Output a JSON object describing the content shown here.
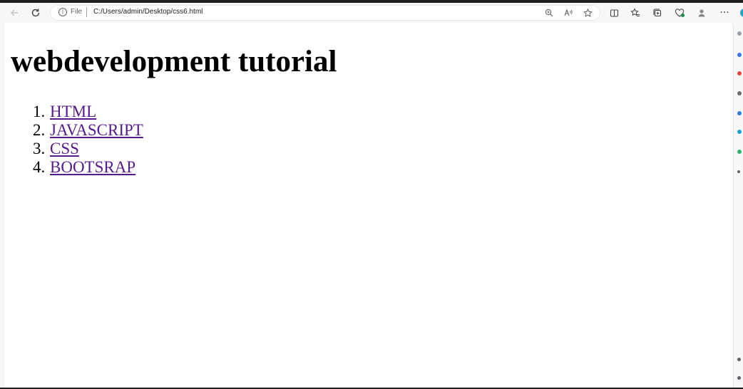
{
  "browser": {
    "address_bar": {
      "scheme_label": "File",
      "url": "C:/Users/admin/Desktop/css6.html"
    },
    "icons": {
      "back": "back-arrow-icon",
      "reload": "reload-icon",
      "info": "info-icon",
      "zoom": "zoom-icon",
      "read_aloud": "read-aloud-icon",
      "favorite": "star-icon",
      "split_screen": "split-screen-icon",
      "favorites": "favorites-icon",
      "collections": "collections-icon",
      "browser_essentials": "heart-pulse-icon",
      "profile": "profile-icon",
      "more": "more-icon",
      "copilot": "copilot-icon"
    }
  },
  "page": {
    "heading": "webdevelopment tutorial",
    "tutorials": [
      {
        "number": "1.",
        "label": "HTML"
      },
      {
        "number": "2.",
        "label": "JAVASCRIPT"
      },
      {
        "number": "3.",
        "label": "CSS"
      },
      {
        "number": "4.",
        "label": "BOOTSRAP"
      }
    ]
  },
  "colors": {
    "visited_link": "#551a8b",
    "toolbar_bg": "#f7f7f7",
    "page_bg": "#ffffff",
    "frame": "#1f1f1f"
  }
}
